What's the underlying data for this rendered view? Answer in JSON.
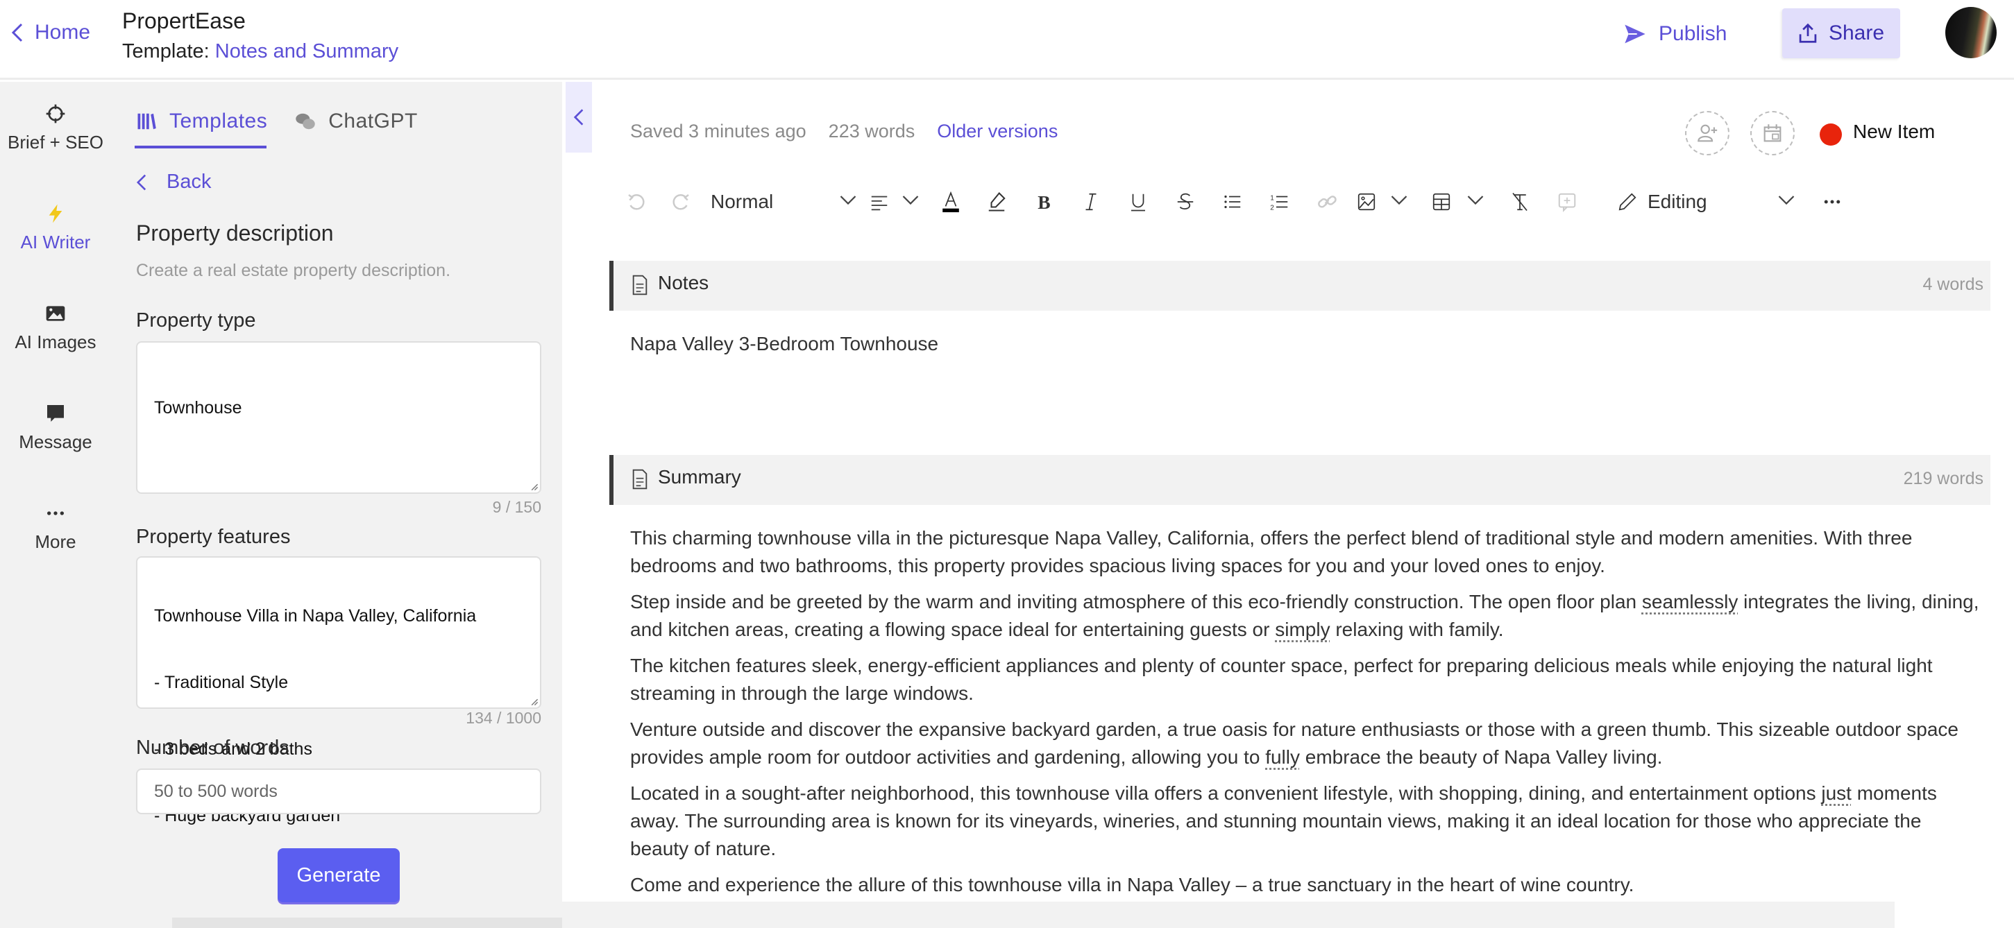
{
  "header": {
    "home_label": "Home",
    "app_title": "PropertEase",
    "template_prefix": "Template:",
    "template_name": "Notes and Summary",
    "publish_label": "Publish",
    "share_label": "Share",
    "avatar_alt": "User avatar"
  },
  "rail": {
    "items": [
      {
        "label": "Brief + SEO",
        "icon": "crosshair-icon"
      },
      {
        "label": "AI Writer",
        "icon": "lightning-icon",
        "active": true
      },
      {
        "label": "AI Images",
        "icon": "image-icon"
      },
      {
        "label": "Message",
        "icon": "chat-bubble-icon"
      },
      {
        "label": "More",
        "icon": "more-icon"
      }
    ]
  },
  "panel": {
    "tabs": [
      {
        "label": "Templates",
        "icon": "books-icon",
        "active": true
      },
      {
        "label": "ChatGPT",
        "icon": "chat-bubbles-icon"
      }
    ],
    "back_label": "Back",
    "title": "Property description",
    "subtitle": "Create a real estate property description.",
    "fields": {
      "property_type": {
        "label": "Property type",
        "value": "Townhouse",
        "counter": "9 / 150"
      },
      "property_features": {
        "label": "Property features",
        "lines": [
          "Townhouse Villa in Napa Valley, California",
          "- Traditional Style",
          "- 3 beds and 2 baths",
          "- Huge backyard garden"
        ],
        "counter": "134 / 1000"
      },
      "number_of_words": {
        "label": "Number of words",
        "placeholder": "50 to 500 words"
      }
    },
    "generate_label": "Generate"
  },
  "editor": {
    "saved_status": "Saved 3 minutes ago",
    "word_count": "223 words",
    "older_versions_label": "Older versions",
    "status": {
      "label": "New Item",
      "color": "#e8240c"
    },
    "toolbar": {
      "text_style": "Normal",
      "mode": "Editing"
    },
    "sections": {
      "notes": {
        "title": "Notes",
        "count": "4 words",
        "text": "Napa Valley 3-Bedroom Townhouse"
      },
      "summary": {
        "title": "Summary",
        "count": "219 words",
        "paragraphs": [
          {
            "parts": [
              {
                "t": "This charming townhouse villa in the picturesque Napa Valley, California, offers the perfect blend of traditional style and modern amenities. With three bedrooms and two bathrooms, this property provides spacious living spaces for you and your loved ones to enjoy."
              }
            ]
          },
          {
            "parts": [
              {
                "t": "Step inside and be greeted by the warm and inviting atmosphere of this eco-friendly construction. The open floor plan "
              },
              {
                "t": "seamlessly",
                "flag": true
              },
              {
                "t": " integrates the living, dining, and kitchen areas, creating a flowing space ideal for entertaining guests or "
              },
              {
                "t": "simply",
                "flag": true
              },
              {
                "t": " relaxing with family."
              }
            ]
          },
          {
            "parts": [
              {
                "t": "The kitchen features sleek, energy-efficient appliances and plenty of counter space, perfect for preparing delicious meals while enjoying the natural light streaming in through the large windows."
              }
            ]
          },
          {
            "parts": [
              {
                "t": "Venture outside and discover the expansive backyard garden, a true oasis for nature enthusiasts or those with a green thumb. This sizeable outdoor space provides ample room for outdoor activities and gardening, allowing you to "
              },
              {
                "t": "fully",
                "flag": true
              },
              {
                "t": " embrace the beauty of Napa Valley living."
              }
            ]
          },
          {
            "parts": [
              {
                "t": "Located in a sought-after neighborhood, this townhouse villa offers a convenient lifestyle, with shopping, dining, and entertainment options "
              },
              {
                "t": "just",
                "flag": true
              },
              {
                "t": " moments away. The surrounding area is known for its vineyards, wineries, and stunning mountain views, making it an ideal location for those who appreciate the beauty of nature."
              }
            ]
          },
          {
            "parts": [
              {
                "t": "Come and experience the allure of this townhouse villa in Napa Valley – a true sanctuary in the heart of wine country."
              }
            ]
          }
        ]
      }
    }
  },
  "colors": {
    "accent": "#5b4fd6",
    "button": "#5b5ef0",
    "share_bg": "#e1defb",
    "panel_bg": "#f2f2f2"
  }
}
